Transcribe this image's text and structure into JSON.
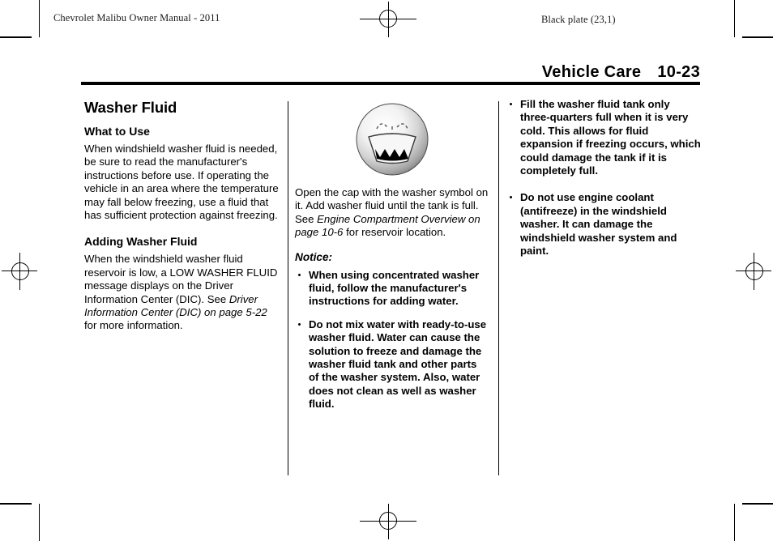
{
  "header": {
    "left_runhead": "Chevrolet Malibu Owner Manual - 2011",
    "right_runhead": "Black plate (23,1)"
  },
  "page_title": {
    "section": "Vehicle Care",
    "page_number": "10-23"
  },
  "columns": {
    "col1": {
      "heading": "Washer Fluid",
      "subheading_1": "What to Use",
      "paragraph_1": "When windshield washer fluid is needed, be sure to read the manufacturer's instructions before use. If operating the vehicle in an area where the temperature may fall below freezing, use a fluid that has sufficient protection against freezing.",
      "subheading_2": "Adding Washer Fluid",
      "paragraph_2_a": "When the windshield washer fluid reservoir is low, a LOW WASHER FLUID message displays on the Driver Information Center (DIC). See ",
      "paragraph_2_ref": "Driver Information Center (DIC) on page 5-22",
      "paragraph_2_b": " for more information."
    },
    "col2": {
      "figure_caption_icon": "washer-fluid-symbol",
      "paragraph_1_a": "Open the cap with the washer symbol on it. Add washer fluid until the tank is full. See ",
      "paragraph_1_ref": "Engine Compartment Overview on page 10-6",
      "paragraph_1_b": " for reservoir location.",
      "notice_label": "Notice:",
      "bullets": [
        "When using concentrated washer fluid, follow the manufacturer's instructions for adding water.",
        "Do not mix water with ready-to-use washer fluid. Water can cause the solution to freeze and damage the washer fluid tank and other parts of the washer system. Also, water does not clean as well as washer fluid."
      ]
    },
    "col3": {
      "bullets": [
        "Fill the washer fluid tank only three-quarters full when it is very cold. This allows for fluid expansion if freezing occurs, which could damage the tank if it is completely full.",
        "Do not use engine coolant (antifreeze) in the windshield washer. It can damage the windshield washer system and paint."
      ]
    }
  },
  "print_marks": {
    "registration_top": "registration-mark",
    "registration_bottom": "registration-mark",
    "registration_left": "registration-mark",
    "registration_right": "registration-mark",
    "corner_crop": "crop-mark"
  },
  "colors": {
    "text": "#000000",
    "rule": "#000000",
    "page_background": "#ffffff"
  }
}
